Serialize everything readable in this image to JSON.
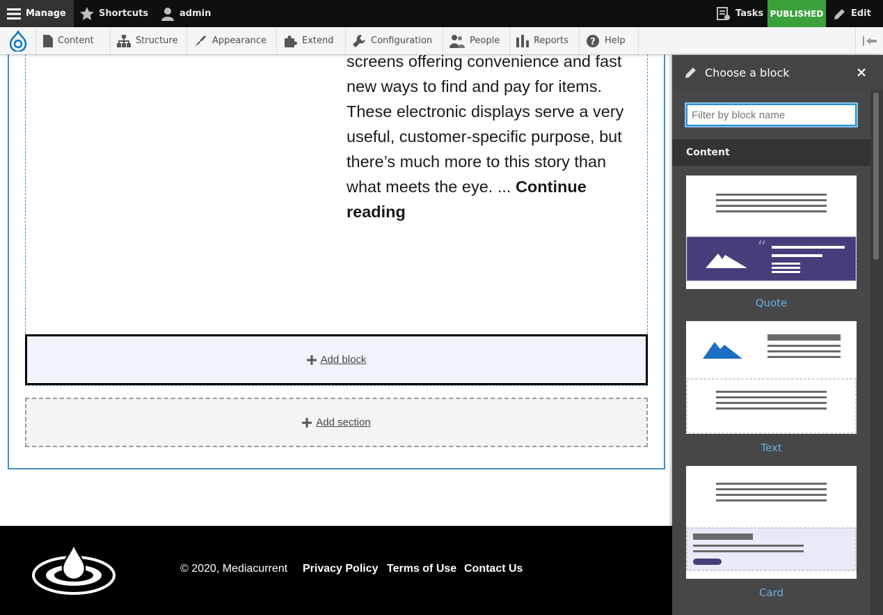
{
  "toolbar": {
    "manage": "Manage",
    "shortcuts": "Shortcuts",
    "user": "admin",
    "tasks": "Tasks",
    "status": "PUBLISHED",
    "edit": "Edit"
  },
  "tray": {
    "items": [
      {
        "label": "Content",
        "icon": "page-icon"
      },
      {
        "label": "Structure",
        "icon": "sitemap-icon"
      },
      {
        "label": "Appearance",
        "icon": "brush-icon"
      },
      {
        "label": "Extend",
        "icon": "puzzle-icon"
      },
      {
        "label": "Configuration",
        "icon": "wrench-icon"
      },
      {
        "label": "People",
        "icon": "people-icon"
      },
      {
        "label": "Reports",
        "icon": "chart-icon"
      },
      {
        "label": "Help",
        "icon": "help-icon"
      }
    ]
  },
  "article": {
    "text": "screens offering convenience and fast new ways to find and pay for items. These electronic displays serve a very useful, customer-specific purpose, but there’s much more to this story than what meets the eye. ... ",
    "continue_link": "Continue reading"
  },
  "layout": {
    "add_block": "Add block",
    "add_section": "Add section"
  },
  "footer": {
    "copyright": "© 2020, Mediacurrent",
    "links": [
      "Privacy Policy",
      "Terms of Use",
      "Contact Us"
    ]
  },
  "panel": {
    "title": "Choose a block",
    "filter_placeholder": "Filter by block name",
    "category": "Content",
    "blocks": [
      "Quote",
      "Text",
      "Card"
    ]
  },
  "colors": {
    "published": "#3aa13b",
    "accent": "#3d8ecd",
    "quote_bg": "#453e7a",
    "link_blue": "#64b0e6"
  }
}
